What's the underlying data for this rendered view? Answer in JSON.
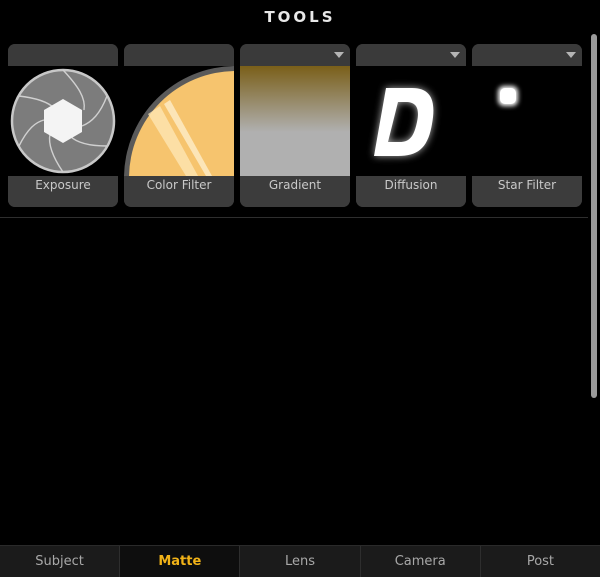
{
  "panel": {
    "title": "TOOLS"
  },
  "tools": [
    {
      "label": "Exposure",
      "icon": "aperture-icon",
      "has_menu": false
    },
    {
      "label": "Color Filter",
      "icon": "color-filter-icon",
      "has_menu": false
    },
    {
      "label": "Gradient",
      "icon": "gradient-icon",
      "has_menu": true
    },
    {
      "label": "Diffusion",
      "icon": "diffusion-icon",
      "has_menu": true
    },
    {
      "label": "Star Filter",
      "icon": "star-filter-icon",
      "has_menu": true
    }
  ],
  "tabs": [
    {
      "label": "Subject",
      "active": false
    },
    {
      "label": "Matte",
      "active": true
    },
    {
      "label": "Lens",
      "active": false
    },
    {
      "label": "Camera",
      "active": false
    },
    {
      "label": "Post",
      "active": false
    }
  ],
  "colors": {
    "active_tab": "#f2b318",
    "filter_amber": "#f6c46e",
    "gradient_top": "#7a5f19",
    "gradient_bottom": "#b0b0b0"
  }
}
